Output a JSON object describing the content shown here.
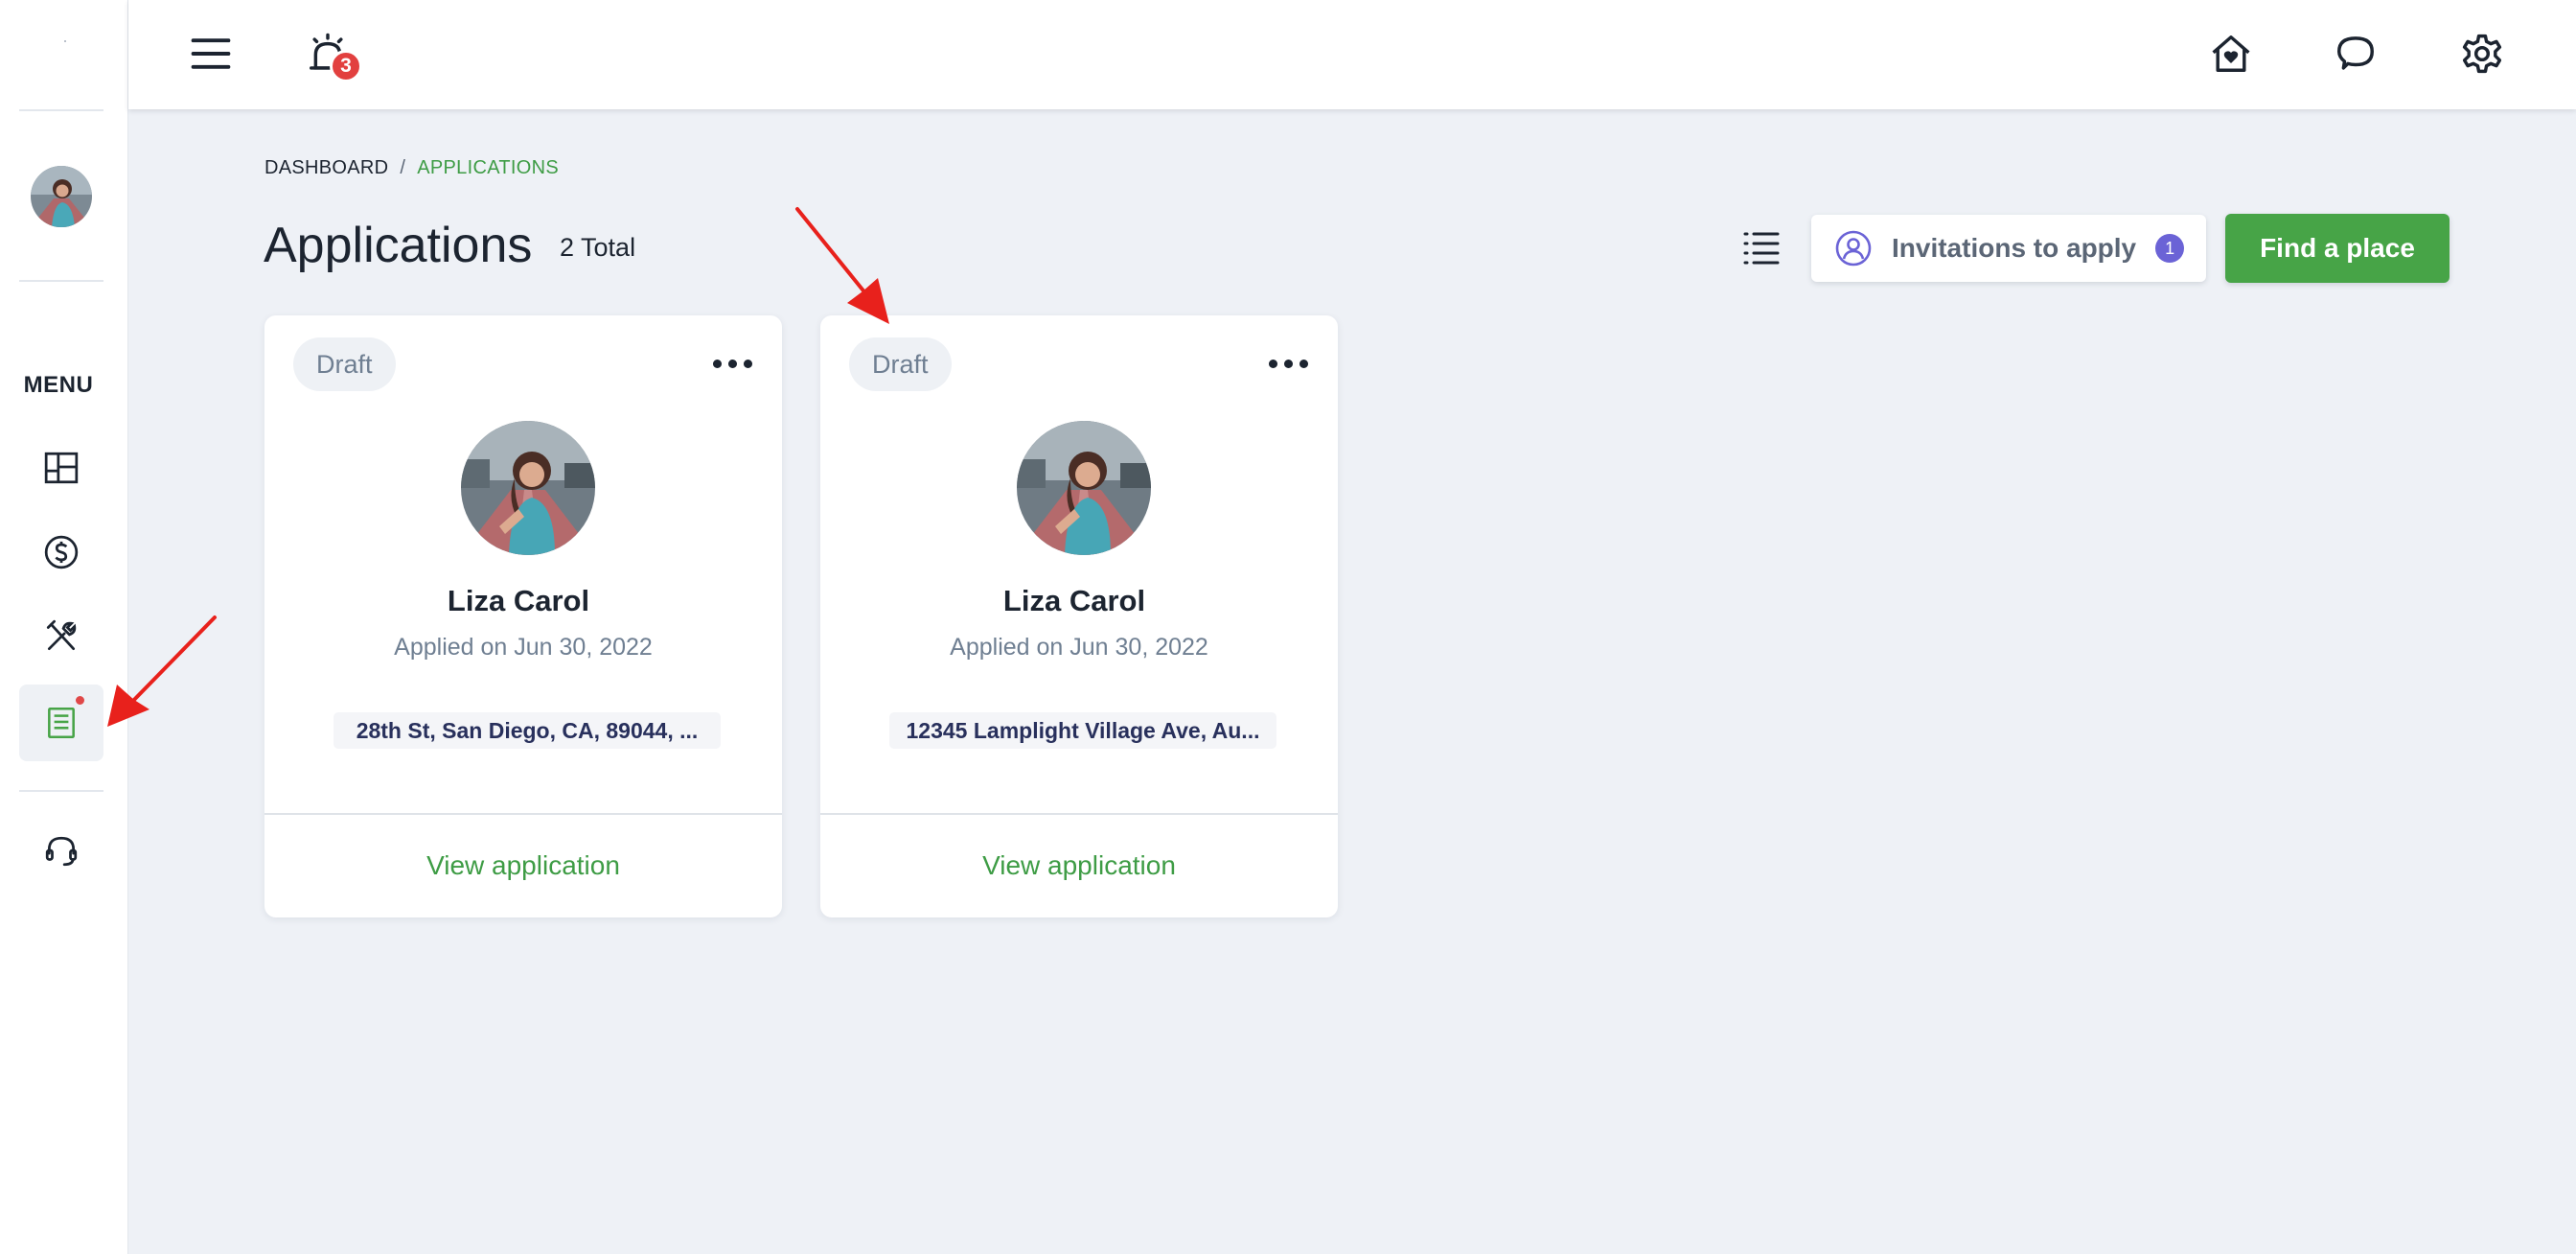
{
  "topbar": {
    "notifications_count": "3",
    "icons": [
      "hamburger-icon",
      "alarm-bell-icon",
      "home-heart-icon",
      "chat-bubble-icon",
      "gear-icon"
    ]
  },
  "sidebar": {
    "menu_label": "MENU",
    "items": [
      {
        "name": "dashboard",
        "icon": "grid-layout-icon"
      },
      {
        "name": "payments",
        "icon": "dollar-circle-icon"
      },
      {
        "name": "maintenance",
        "icon": "tools-icon"
      },
      {
        "name": "applications",
        "icon": "document-list-icon",
        "active": true,
        "has_notification": true
      },
      {
        "name": "support",
        "icon": "headset-icon"
      }
    ]
  },
  "breadcrumb": {
    "root": "DASHBOARD",
    "separator": "/",
    "current": "APPLICATIONS"
  },
  "page": {
    "title": "Applications",
    "total": "2 Total"
  },
  "actions": {
    "invitations_label": "Invitations to apply",
    "invitations_count": "1",
    "find_place_label": "Find a place"
  },
  "cards": [
    {
      "status": "Draft",
      "name": "Liza Carol",
      "applied": "Applied on Jun 30, 2022",
      "address": "28th St, San Diego, CA, 89044, ...",
      "link": "View application"
    },
    {
      "status": "Draft",
      "name": "Liza Carol",
      "applied": "Applied on Jun 30, 2022",
      "address": "12345 Lamplight Village Ave, Au...",
      "link": "View application"
    }
  ],
  "colors": {
    "accent_green": "#47a447",
    "link_green": "#3e9c45",
    "badge_red": "#e2403f",
    "invite_purple": "#6b63d6",
    "background": "#eef1f6",
    "annotation_red": "#e8211c"
  }
}
